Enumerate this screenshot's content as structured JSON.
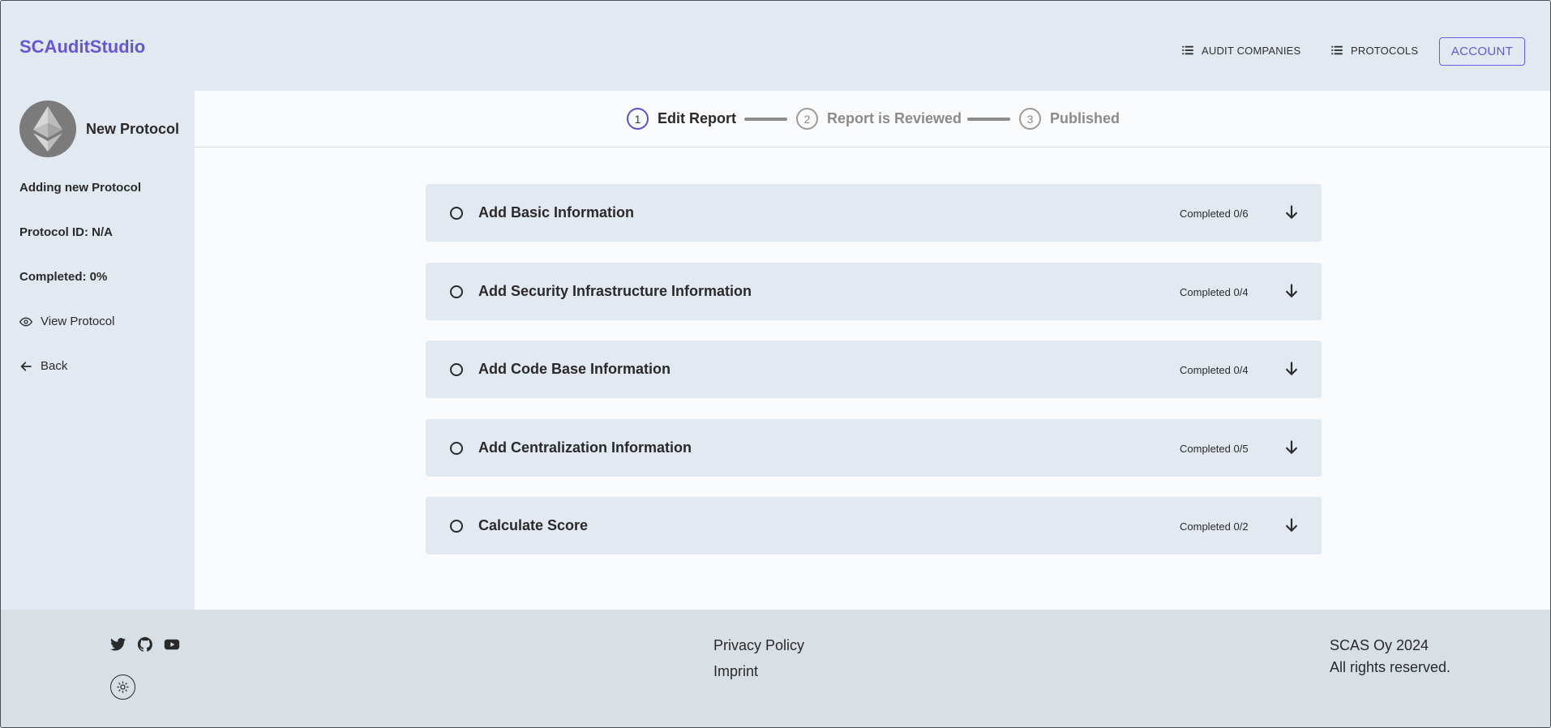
{
  "header": {
    "brand": "SCAuditStudio",
    "nav": [
      {
        "label": "AUDIT COMPANIES",
        "icon": "list-icon"
      },
      {
        "label": "PROTOCOLS",
        "icon": "list-icon"
      }
    ],
    "account_label": "ACCOUNT"
  },
  "sidebar": {
    "protocol_name": "New Protocol",
    "avatar_icon": "ethereum-icon",
    "status": "Adding new Protocol",
    "protocol_id": "Protocol ID: N/A",
    "completed": "Completed: 0%",
    "view_label": "View Protocol",
    "back_label": "Back"
  },
  "stepper": {
    "steps": [
      {
        "number": "1",
        "label": "Edit Report",
        "active": true
      },
      {
        "number": "2",
        "label": "Report is Reviewed",
        "active": false
      },
      {
        "number": "3",
        "label": "Published",
        "active": false
      }
    ]
  },
  "sections": [
    {
      "title": "Add Basic Information",
      "status": "Completed 0/6"
    },
    {
      "title": "Add Security Infrastructure Information",
      "status": "Completed 0/4"
    },
    {
      "title": "Add Code Base Information",
      "status": "Completed 0/4"
    },
    {
      "title": "Add Centralization Information",
      "status": "Completed 0/5"
    },
    {
      "title": "Calculate Score",
      "status": "Completed 0/2"
    }
  ],
  "footer": {
    "social": [
      "twitter-icon",
      "github-icon",
      "youtube-icon"
    ],
    "theme_icon": "sun-icon",
    "links": [
      "Privacy Policy",
      "Imprint"
    ],
    "copyright_line1": "SCAS Oy 2024",
    "copyright_line2": "All rights reserved."
  },
  "colors": {
    "accent": "#6655d6",
    "background": "#e3e9f1",
    "main_background": "#f8fafc",
    "footer_background": "#d8dfe5"
  }
}
